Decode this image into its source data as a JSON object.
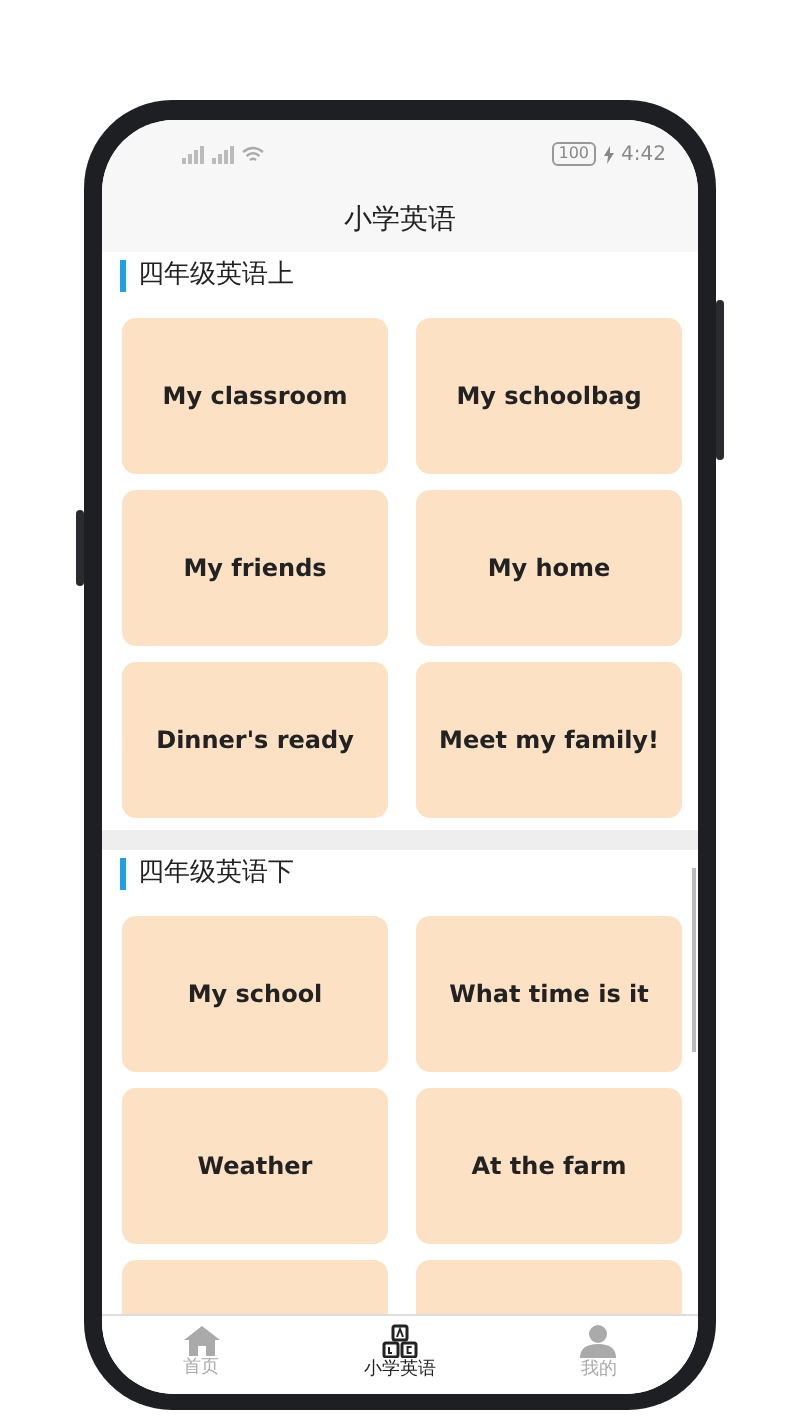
{
  "status_bar": {
    "battery": "100",
    "time": "4:42"
  },
  "title": "小学英语",
  "sections": [
    {
      "heading": "四年级英语上",
      "lessons": [
        {
          "kind": "card",
          "title": "My classroom"
        },
        {
          "kind": "card",
          "title": "My schoolbag"
        },
        {
          "kind": "card",
          "title": "My friends"
        },
        {
          "kind": "card",
          "title": "My home"
        },
        {
          "kind": "card",
          "title": "Dinner's ready"
        },
        {
          "kind": "card",
          "title": "Meet my family!"
        }
      ]
    },
    {
      "heading": "四年级英语下",
      "lessons": [
        {
          "kind": "card",
          "title": "My school"
        },
        {
          "kind": "card",
          "title": "What time is it"
        },
        {
          "kind": "card",
          "title": "Weather"
        },
        {
          "kind": "card",
          "title": "At the farm"
        },
        {
          "kind": "cut"
        },
        {
          "kind": "cut"
        }
      ]
    }
  ],
  "tabs": [
    {
      "kind": "home",
      "label": "首页",
      "selected": false
    },
    {
      "kind": "abc",
      "label": "小学英语",
      "selected": true
    },
    {
      "kind": "person",
      "label": "我的",
      "selected": false
    }
  ]
}
